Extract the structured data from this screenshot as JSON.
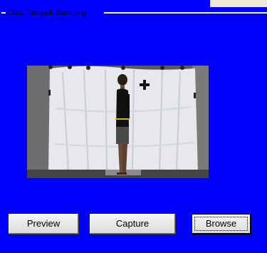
{
  "panel": {
    "title": "Citra Tampak Samping",
    "background": "#0000ff"
  },
  "photo": {
    "subject": "person-side-view"
  },
  "buttons": {
    "preview_label": "Preview",
    "capture_label": "Capture",
    "browse_label": "Browse"
  }
}
